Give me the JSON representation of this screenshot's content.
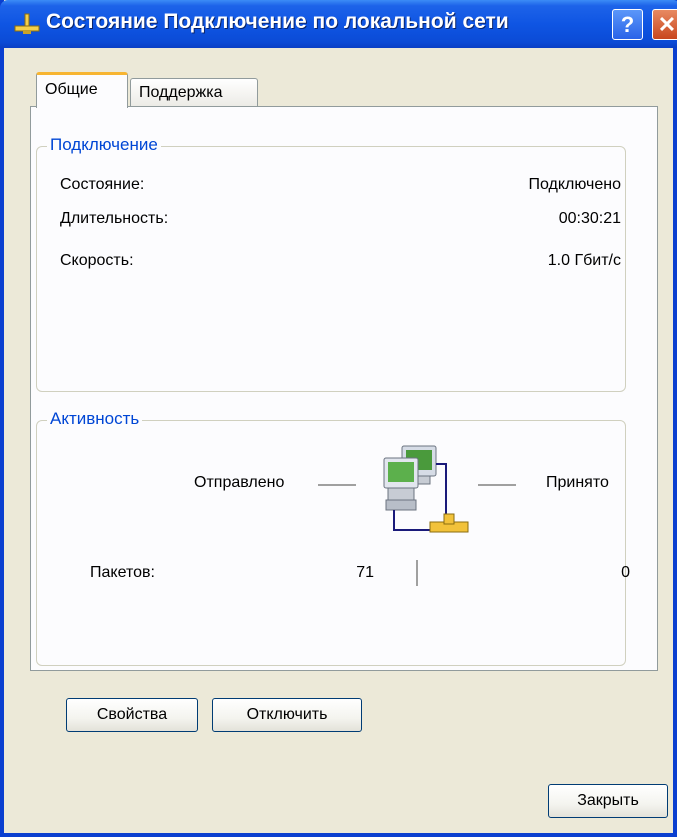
{
  "window": {
    "title": "Состояние Подключение по локальной сети",
    "help_label": "?",
    "close_label": "✕"
  },
  "tabs": [
    {
      "label": "Общие",
      "active": true
    },
    {
      "label": "Поддержка",
      "active": false
    }
  ],
  "connection": {
    "title": "Подключение",
    "rows": [
      {
        "label": "Состояние:",
        "value": "Подключено"
      },
      {
        "label": "Длительность:",
        "value": "00:30:21"
      },
      {
        "label": "Скорость:",
        "value": "1.0 Гбит/с"
      }
    ]
  },
  "activity": {
    "title": "Активность",
    "sent_label": "Отправлено",
    "received_label": "Принято",
    "packets_label": "Пакетов:",
    "packets_sent": "71",
    "packets_received": "0"
  },
  "buttons": {
    "properties": "Свойства",
    "disable": "Отключить",
    "close": "Закрыть"
  },
  "colors": {
    "titlebar": "#0b4bd6",
    "group_title": "#0046d5",
    "dialog_bg": "#ece9d8",
    "tab_highlight": "#f7b532"
  }
}
